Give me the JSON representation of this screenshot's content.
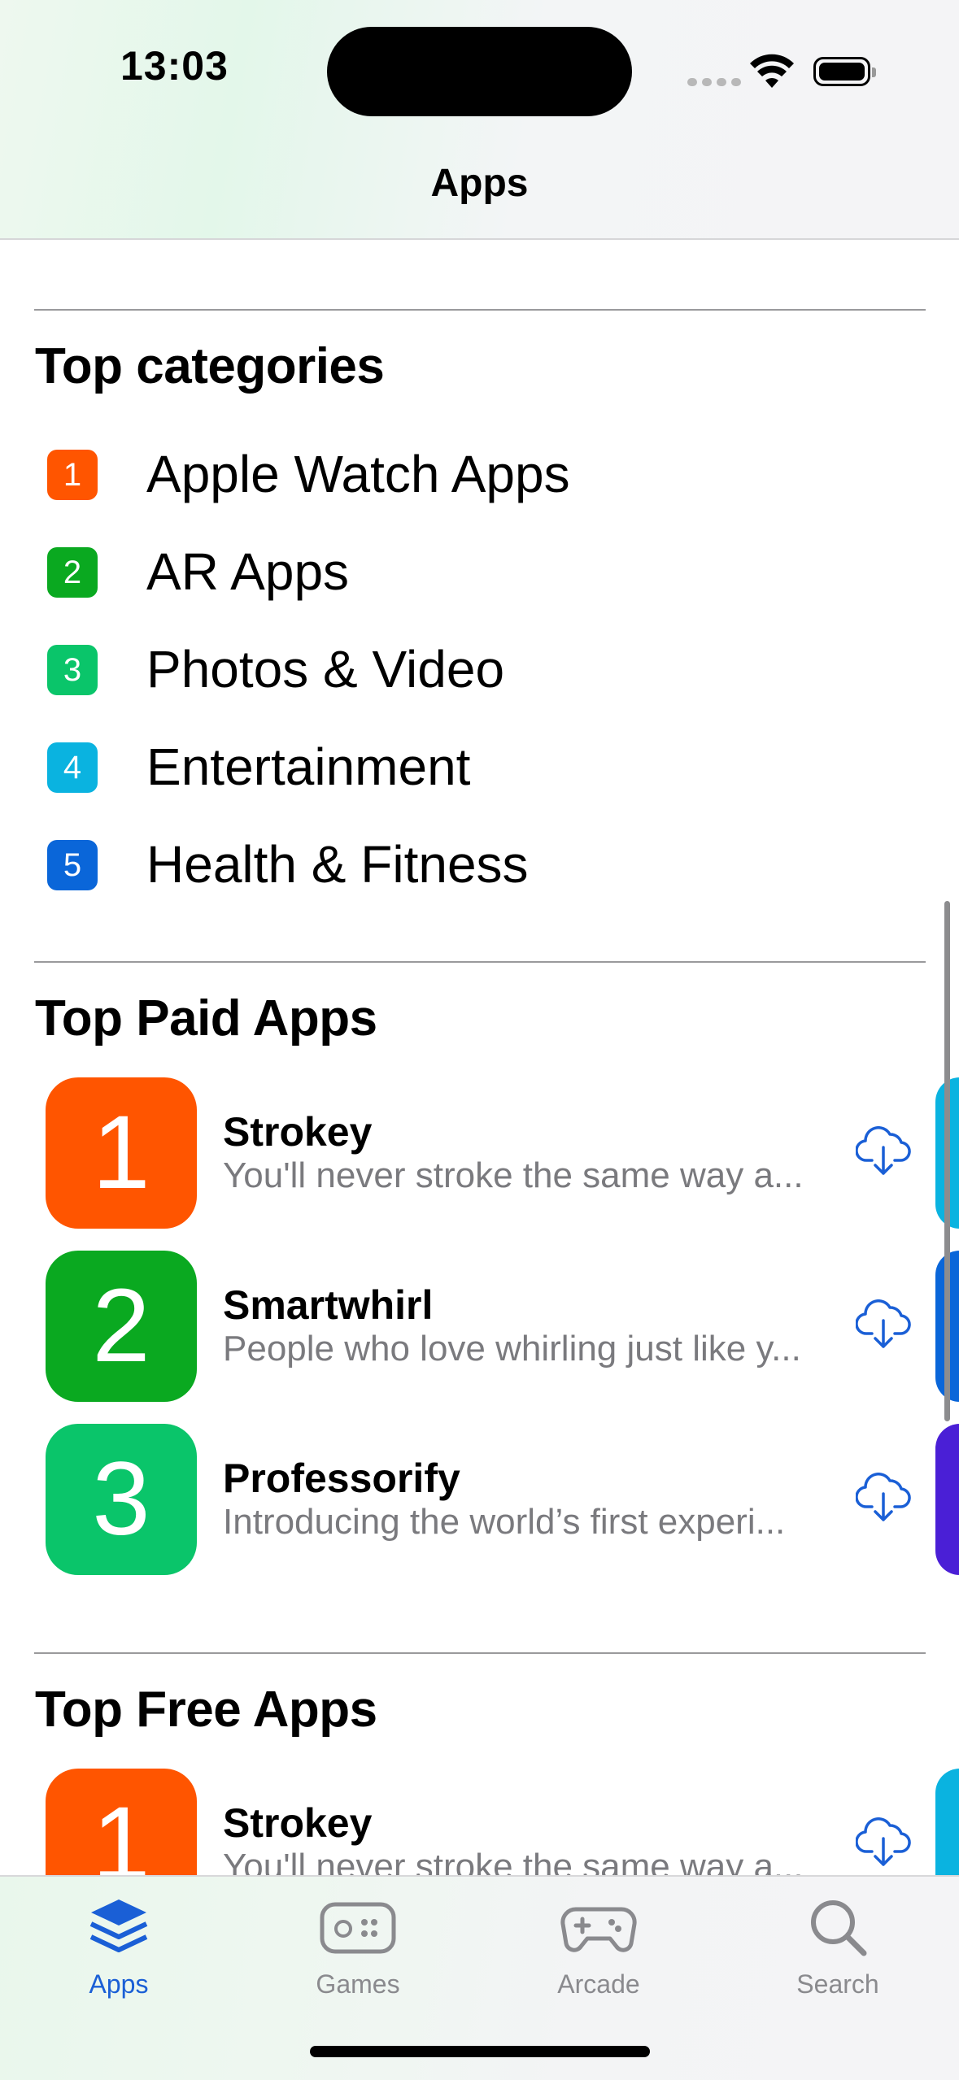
{
  "status_bar": {
    "time": "13:03"
  },
  "nav": {
    "title": "Apps"
  },
  "top_categories": {
    "title": "Top categories",
    "items": [
      {
        "rank": "1",
        "label": "Apple Watch Apps",
        "color": "#ff5500"
      },
      {
        "rank": "2",
        "label": "AR Apps",
        "color": "#0aa920"
      },
      {
        "rank": "3",
        "label": "Photos & Video",
        "color": "#0ac56a"
      },
      {
        "rank": "4",
        "label": "Entertainment",
        "color": "#0ab3e0"
      },
      {
        "rank": "5",
        "label": "Health & Fitness",
        "color": "#0a66d9"
      }
    ]
  },
  "top_paid": {
    "title": "Top Paid Apps",
    "items": [
      {
        "rank": "1",
        "name": "Strokey",
        "desc": "You'll never stroke the same way a...",
        "color": "#ff5500"
      },
      {
        "rank": "2",
        "name": "Smartwhirl",
        "desc": "People who love whirling just like y...",
        "color": "#0aa920"
      },
      {
        "rank": "3",
        "name": "Professorify",
        "desc": "Introducing the world’s first experi...",
        "color": "#0ac56a"
      }
    ]
  },
  "top_free": {
    "title": "Top Free Apps",
    "items": [
      {
        "rank": "1",
        "name": "Strokey",
        "desc": "You'll never stroke the same way a...",
        "color": "#ff5500"
      }
    ]
  },
  "tabbar": {
    "tabs": [
      {
        "label": "Apps",
        "icon": "apps-stack-icon",
        "active": true
      },
      {
        "label": "Games",
        "icon": "games-controller-icon",
        "active": false
      },
      {
        "label": "Arcade",
        "icon": "arcade-joystick-icon",
        "active": false
      },
      {
        "label": "Search",
        "icon": "search-icon",
        "active": false
      }
    ]
  },
  "colors": {
    "accent": "#1a5fd6",
    "secondary_text": "#7a7a7e"
  }
}
